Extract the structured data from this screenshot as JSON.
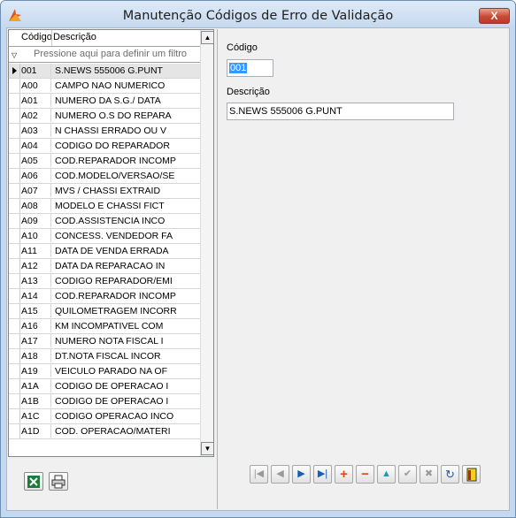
{
  "window": {
    "title": "Manutenção Códigos de Erro de Validação",
    "close_label": "X"
  },
  "grid": {
    "columns": [
      "Código",
      "Descrição"
    ],
    "filter_placeholder": "Pressione aqui para definir um filtro",
    "rows": [
      {
        "code": "001",
        "desc": "S.NEWS 555006 G.PUNT"
      },
      {
        "code": "A00",
        "desc": "CAMPO NAO NUMERICO"
      },
      {
        "code": "A01",
        "desc": "NUMERO DA S.G./ DATA"
      },
      {
        "code": "A02",
        "desc": "NUMERO O.S DO REPARA"
      },
      {
        "code": "A03",
        "desc": "N CHASSI ERRADO OU V"
      },
      {
        "code": "A04",
        "desc": "CODIGO DO REPARADOR"
      },
      {
        "code": "A05",
        "desc": "COD.REPARADOR INCOMP"
      },
      {
        "code": "A06",
        "desc": "COD.MODELO/VERSAO/SE"
      },
      {
        "code": "A07",
        "desc": "MVS / CHASSI EXTRAID"
      },
      {
        "code": "A08",
        "desc": "MODELO E CHASSI FICT"
      },
      {
        "code": "A09",
        "desc": "COD.ASSISTENCIA INCO"
      },
      {
        "code": "A10",
        "desc": "CONCESS. VENDEDOR FA"
      },
      {
        "code": "A11",
        "desc": "DATA DE VENDA ERRADA"
      },
      {
        "code": "A12",
        "desc": "DATA DA REPARACAO IN"
      },
      {
        "code": "A13",
        "desc": "CODIGO REPARADOR/EMI"
      },
      {
        "code": "A14",
        "desc": "COD.REPARADOR INCOMP"
      },
      {
        "code": "A15",
        "desc": "QUILOMETRAGEM INCORR"
      },
      {
        "code": "A16",
        "desc": "KM INCOMPATIVEL COM"
      },
      {
        "code": "A17",
        "desc": "NUMERO NOTA FISCAL I"
      },
      {
        "code": "A18",
        "desc": "DT.NOTA FISCAL INCOR"
      },
      {
        "code": "A19",
        "desc": "VEICULO PARADO NA OF"
      },
      {
        "code": "A1A",
        "desc": "CODIGO DE OPERACAO I"
      },
      {
        "code": "A1B",
        "desc": "CODIGO DE OPERACAO I"
      },
      {
        "code": "A1C",
        "desc": "CODIGO OPERACAO INCO"
      },
      {
        "code": "A1D",
        "desc": "COD. OPERACAO/MATERI"
      }
    ]
  },
  "form": {
    "codigo_label": "Código",
    "codigo_value": "001",
    "descricao_label": "Descrição",
    "descricao_value": "S.NEWS 555006 G.PUNT"
  },
  "icons": {
    "excel": "excel-icon",
    "print": "print-icon"
  },
  "colors": {
    "selection": "#3399ff",
    "close": "#c74a33"
  }
}
